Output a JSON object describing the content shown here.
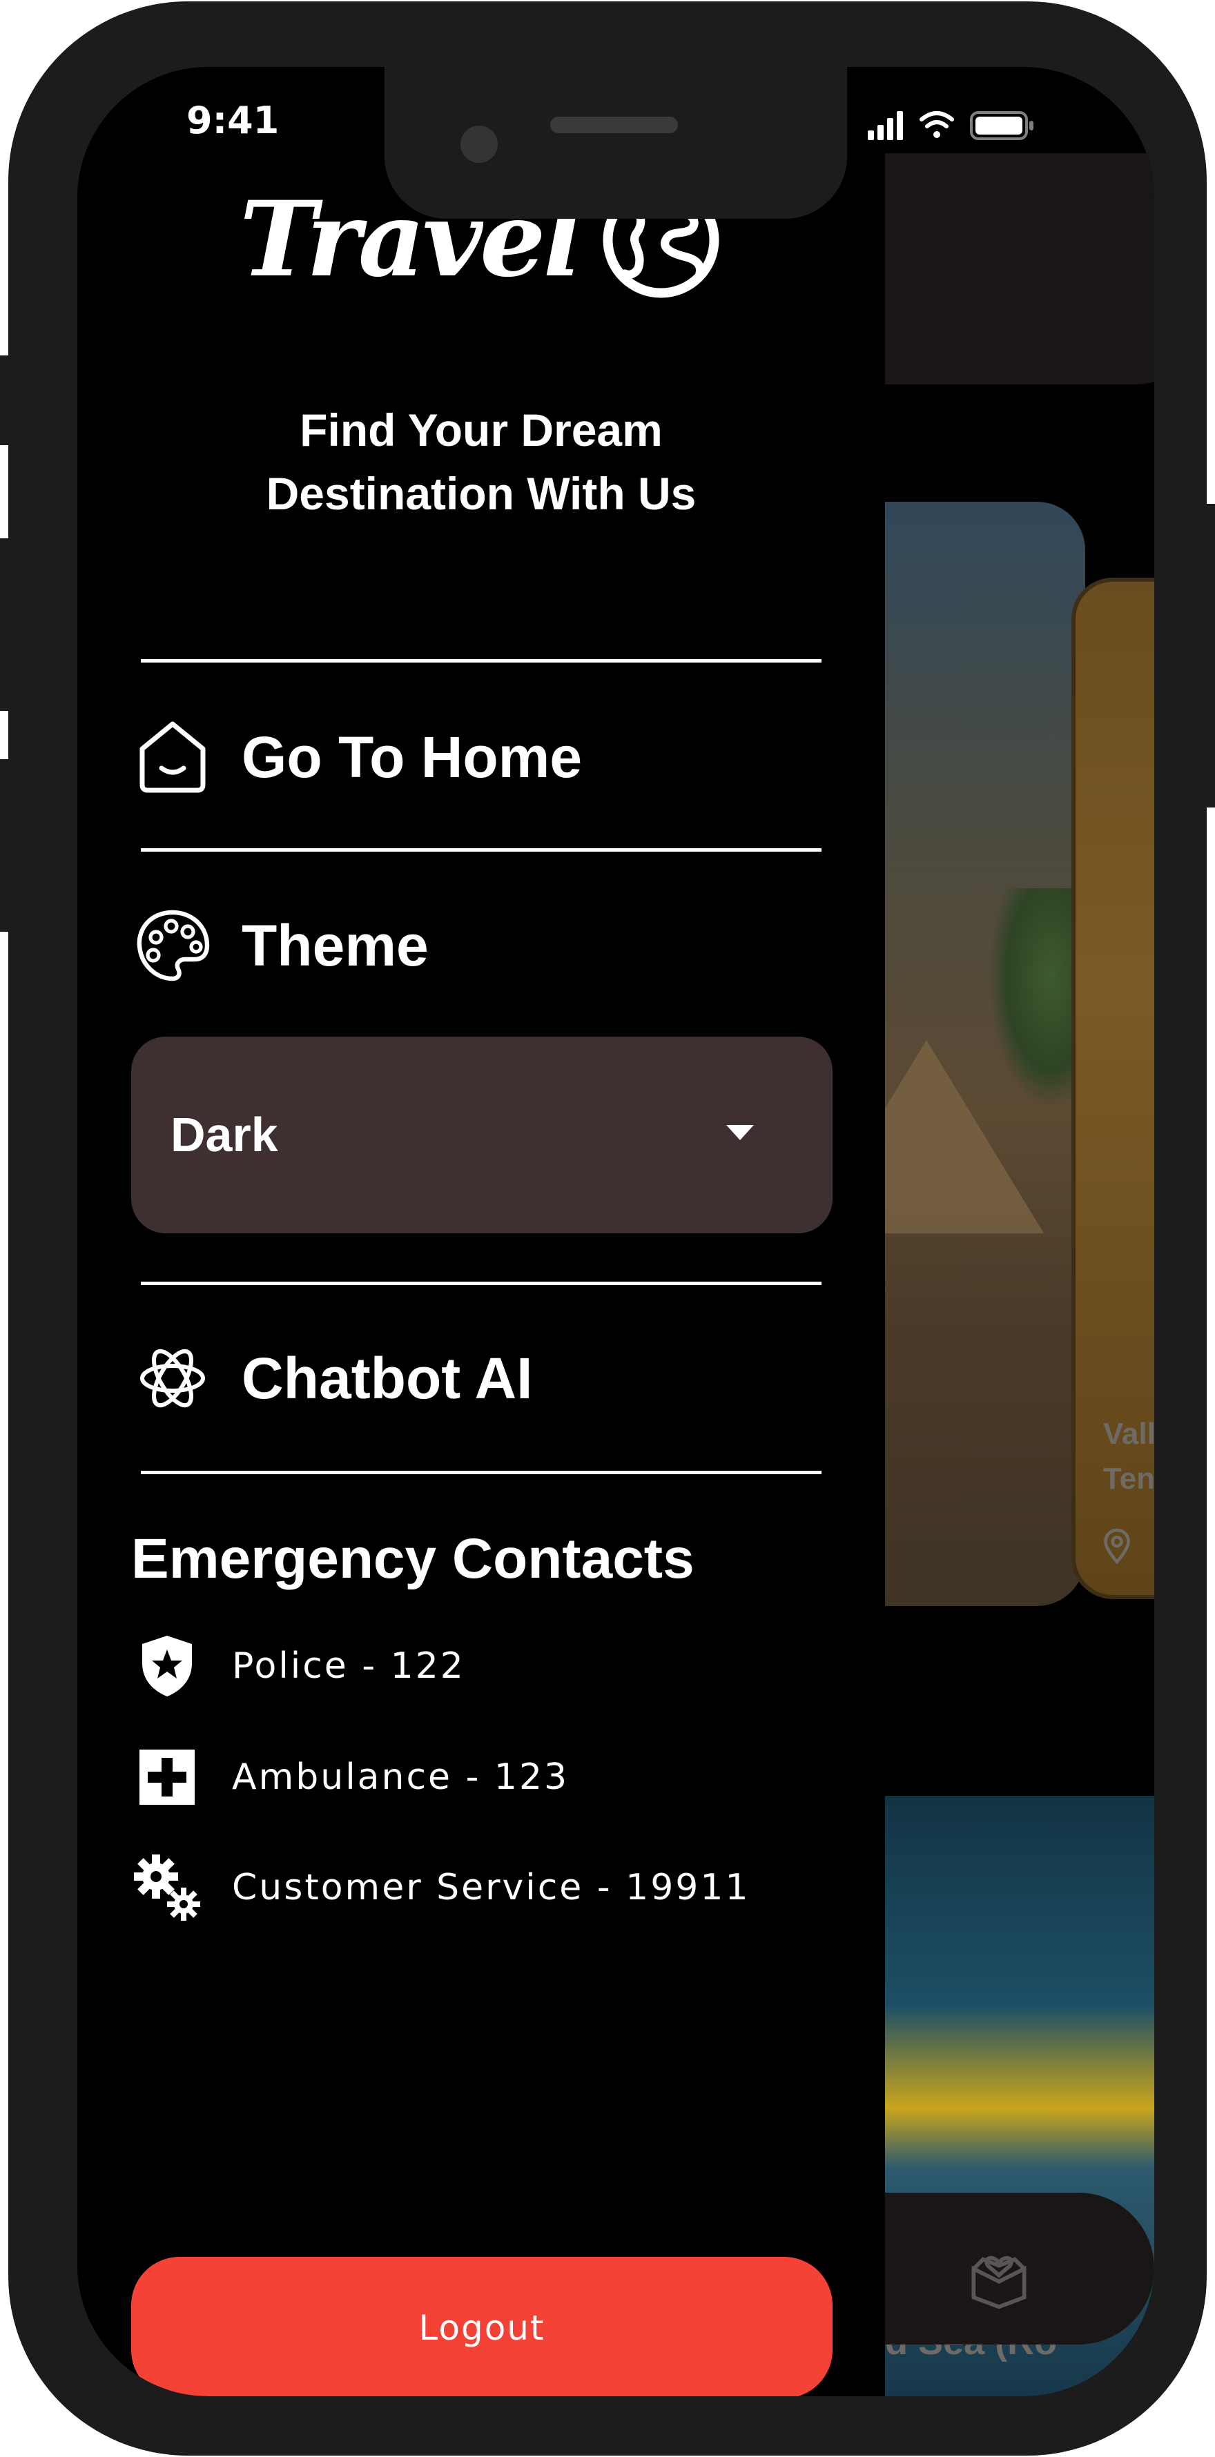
{
  "status_bar": {
    "time": "9:41"
  },
  "drawer": {
    "logo_text": "Travel",
    "tagline_line1": "Find Your Dream",
    "tagline_line2": "Destination With Us",
    "menu": {
      "home_label": "Go To Home",
      "theme_label": "Theme",
      "chatbot_label": "Chatbot AI"
    },
    "theme_select": {
      "value": "Dark"
    },
    "emergency": {
      "title": "Emergency Contacts",
      "contacts": [
        {
          "label": "Police - 122",
          "icon": "police-shield-icon"
        },
        {
          "label": "Ambulance - 123",
          "icon": "first-aid-icon"
        },
        {
          "label": "Customer Service - 19911",
          "icon": "gears-icon"
        }
      ]
    },
    "logout_label": "Logout"
  },
  "background": {
    "card_title_line1": "Vall",
    "card_title_line2": "Ten",
    "sea_label": "ked Sea (Ro"
  },
  "colors": {
    "drawer_bg": "#000000",
    "select_bg": "#3e2f30",
    "logout_bg": "#f44336",
    "text": "#ffffff"
  }
}
